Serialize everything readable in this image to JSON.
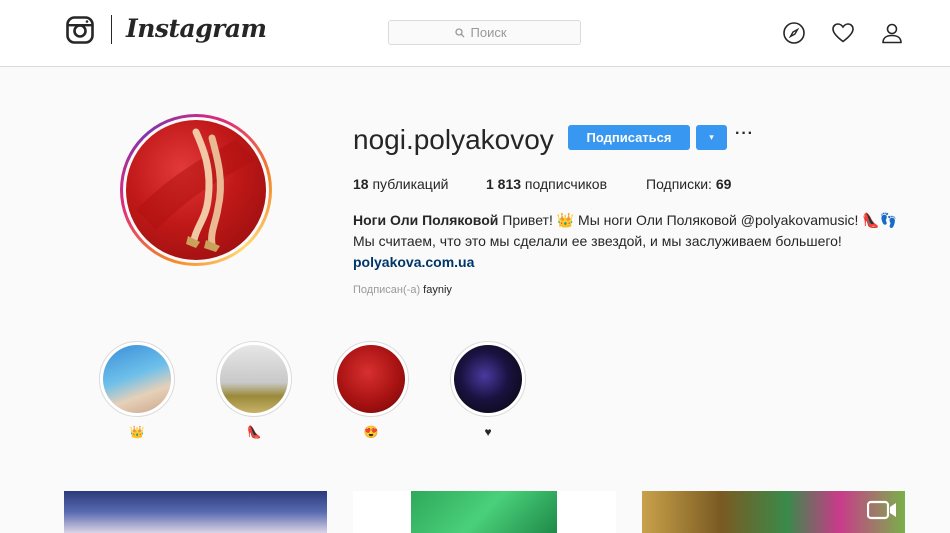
{
  "nav": {
    "wordmark": "Instagram",
    "search_placeholder": "Поиск"
  },
  "profile": {
    "username": "nogi.polyakovoy",
    "follow_label": "Подписаться",
    "dropdown_label": "▾",
    "more_label": "···",
    "stats": {
      "posts_count": "18",
      "posts_label": " публикаций",
      "followers_count": "1 813",
      "followers_label": " подписчиков",
      "following_label": "Подписки: ",
      "following_count": "69"
    },
    "bio": {
      "full_name": "Ноги Оли Поляковой",
      "line1_text": " Привет! 👑 Мы ноги Оли Поляковой @polyakovamusic! 👠👣",
      "line2_text": "Мы считаем, что это мы сделали ее звездой, и мы заслуживаем большего!",
      "website": "polyakova.com.ua"
    },
    "followed_by_label": "Подписан(-а) ",
    "followed_by_name": "fayniy"
  },
  "highlights": [
    {
      "label": "👑"
    },
    {
      "label": "👠"
    },
    {
      "label": "😍"
    },
    {
      "label": "♥"
    }
  ],
  "colors": {
    "accent": "#3897f0",
    "link": "#003569",
    "border": "#dbdbdb",
    "background": "#fafafa"
  },
  "icons": [
    "instagram-glyph-icon",
    "search-icon",
    "compass-icon",
    "heart-icon",
    "profile-icon",
    "video-icon"
  ]
}
